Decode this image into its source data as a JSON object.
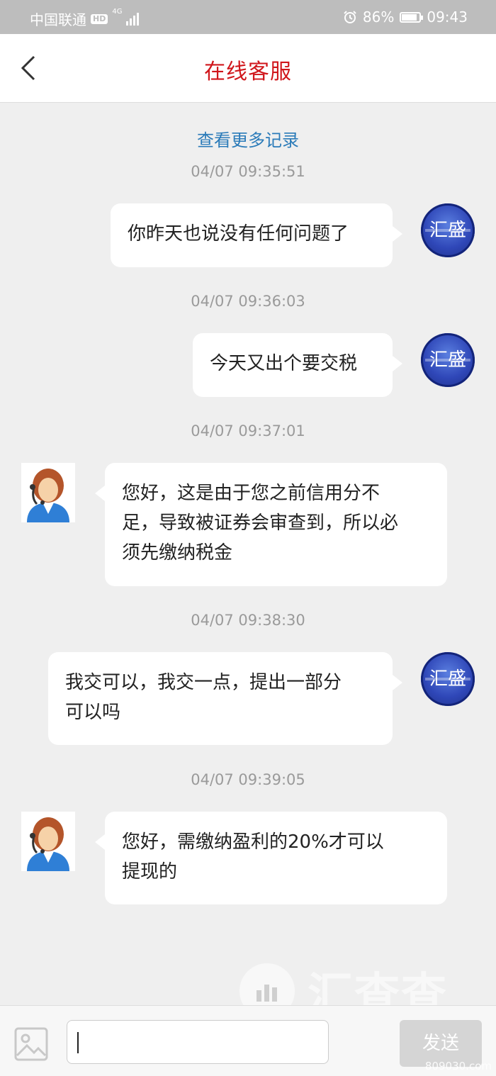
{
  "status_bar": {
    "carrier": "中国联通",
    "hd_badge": "HD",
    "network": "4G",
    "battery": "86%",
    "battery_level": 0.86,
    "time": "09:43"
  },
  "header": {
    "title": "在线客服",
    "back_icon": "chevron-left-icon"
  },
  "chat": {
    "more_link": "查看更多记录",
    "user_avatar_text": "汇盛",
    "messages": [
      {
        "time": "04/07 09:35:51",
        "sender": "user",
        "text": "你昨天也说没有任何问题了"
      },
      {
        "time": "04/07 09:36:03",
        "sender": "user",
        "text": "今天又出个要交税"
      },
      {
        "time": "04/07 09:37:01",
        "sender": "agent",
        "lines": [
          "您好，这是由于您之前信用分不",
          "足，导致被证券会审查到，所以必",
          "须先缴纳税金"
        ]
      },
      {
        "time": "04/07 09:38:30",
        "sender": "user",
        "lines": [
          "我交可以，我交一点，提出一部分",
          "可以吗"
        ]
      },
      {
        "time": "04/07 09:39:05",
        "sender": "agent",
        "lines": [
          "您好，需缴纳盈利的20%才可以",
          "提现的"
        ]
      }
    ]
  },
  "input_bar": {
    "send_label": "发送",
    "image_icon": "image-icon"
  },
  "watermark": {
    "text": "汇查查",
    "site": "809030.com"
  }
}
